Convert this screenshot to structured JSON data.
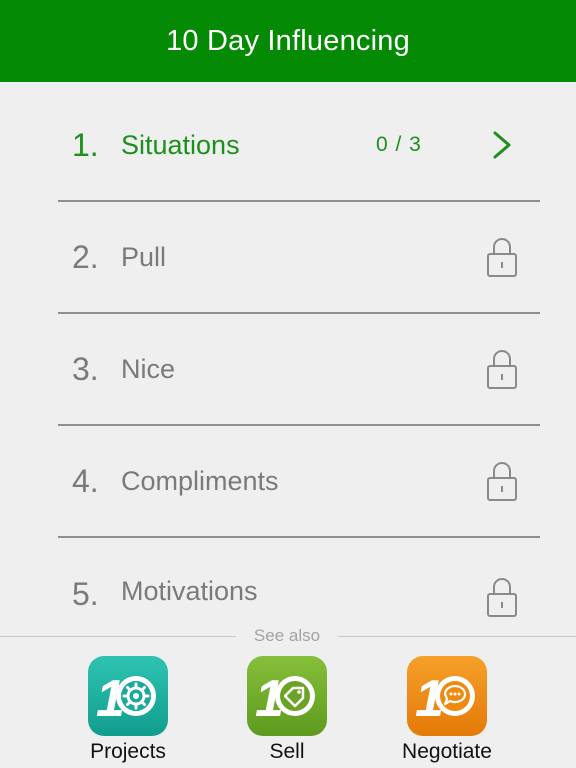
{
  "header": {
    "title": "10 Day Influencing"
  },
  "lessons": [
    {
      "number": "1.",
      "label": "Situations",
      "progress": "0 / 3",
      "state": "open",
      "icon": "chevron-right-icon"
    },
    {
      "number": "2.",
      "label": "Pull",
      "state": "locked",
      "icon": "lock-icon"
    },
    {
      "number": "3.",
      "label": "Nice",
      "state": "locked",
      "icon": "lock-icon"
    },
    {
      "number": "4.",
      "label": "Compliments",
      "state": "locked",
      "icon": "lock-icon"
    },
    {
      "number": "5.",
      "label": "Motivations",
      "state": "locked",
      "icon": "lock-icon"
    }
  ],
  "see_also": {
    "title": "See also",
    "apps": [
      {
        "label": "Projects",
        "icon": "gear-icon",
        "color": "#1aa99a"
      },
      {
        "label": "Sell",
        "icon": "tag-icon",
        "color": "#6aa325"
      },
      {
        "label": "Negotiate",
        "icon": "speech-bubble-icon",
        "color": "#ef8a10"
      }
    ]
  },
  "colors": {
    "header_bg": "#058a05",
    "accent": "#1d8f1d",
    "background": "#efefef",
    "muted_text": "#7a7a7a"
  }
}
